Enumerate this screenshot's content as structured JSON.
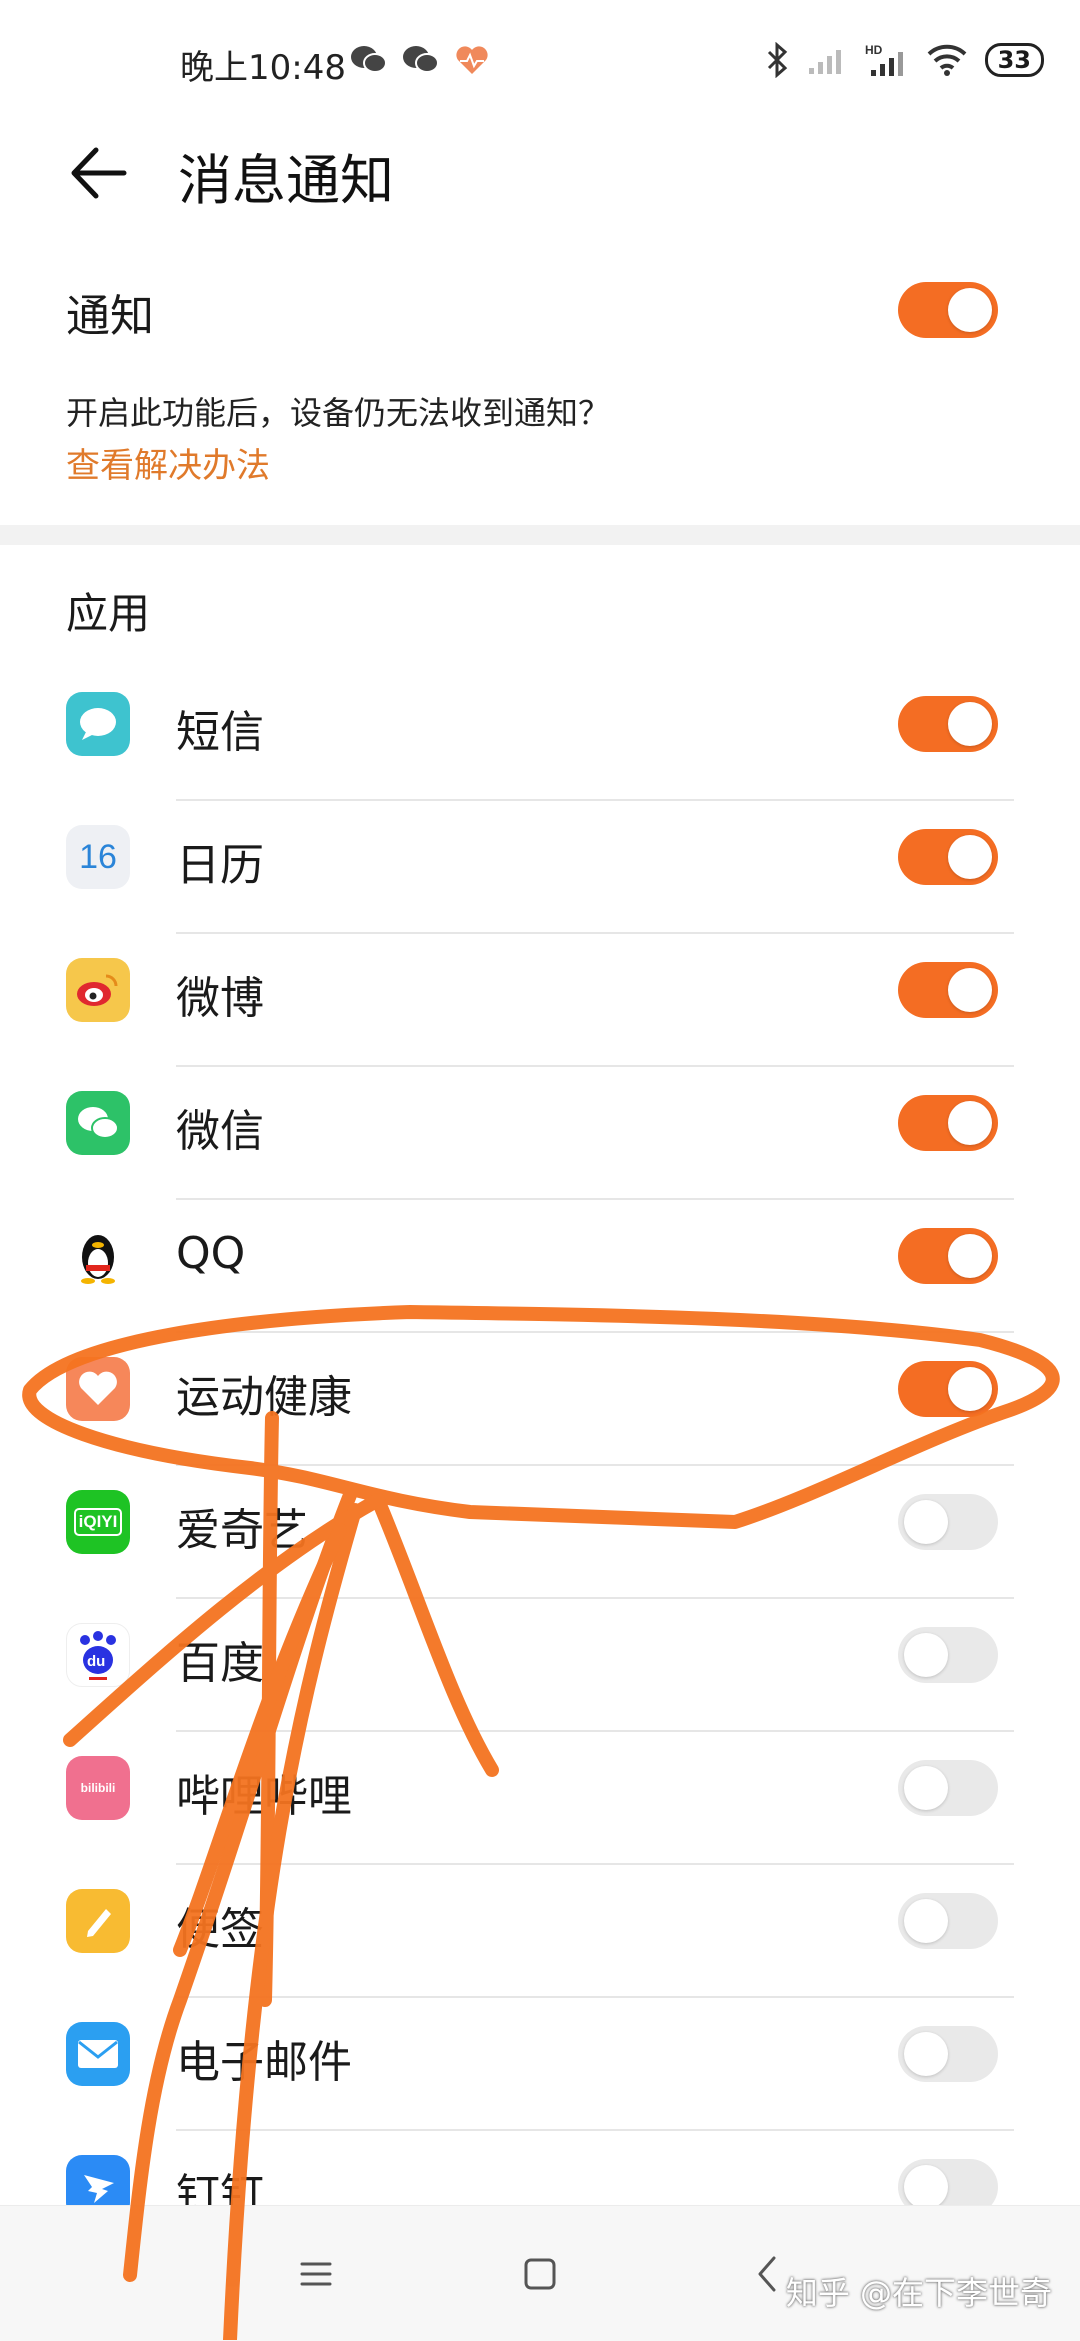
{
  "status_bar": {
    "time": "晚上10:48",
    "battery": "33",
    "left_icons": [
      "wechat-icon",
      "wechat-icon",
      "health-icon"
    ],
    "right_icons": [
      "bluetooth-icon",
      "signal-icon",
      "hd-signal-icon",
      "wifi-icon"
    ]
  },
  "header": {
    "title": "消息通知",
    "back_icon": "back-arrow-icon"
  },
  "notifications": {
    "label": "通知",
    "enabled": true,
    "description": "开启此功能后，设备仍无法收到通知？",
    "link": "查看解决办法"
  },
  "apps_section": {
    "label": "应用"
  },
  "apps": [
    {
      "name": "短信",
      "icon": "sms-icon",
      "color": "#3ec3cf",
      "enabled": true
    },
    {
      "name": "日历",
      "icon": "calendar-icon",
      "icon_text": "16",
      "color": "#eef0f4",
      "enabled": true
    },
    {
      "name": "微博",
      "icon": "weibo-icon",
      "color": "#f6c74b",
      "enabled": true
    },
    {
      "name": "微信",
      "icon": "wechat-app-icon",
      "color": "#2dc268",
      "enabled": true
    },
    {
      "name": "QQ",
      "icon": "qq-icon",
      "color": "#ffffff",
      "enabled": true
    },
    {
      "name": "运动健康",
      "icon": "health-app-icon",
      "color": "#f6875a",
      "enabled": true
    },
    {
      "name": "爱奇艺",
      "icon": "iqiyi-icon",
      "icon_text": "iQIYI",
      "color": "#1ec324",
      "enabled": false
    },
    {
      "name": "百度",
      "icon": "baidu-icon",
      "icon_text": "du",
      "color": "#ffffff",
      "enabled": false
    },
    {
      "name": "哔哩哔哩",
      "icon": "bilibili-icon",
      "icon_text": "bilibili",
      "color": "#f0708f",
      "enabled": false
    },
    {
      "name": "便签",
      "icon": "notes-icon",
      "color": "#f8bb32",
      "enabled": false
    },
    {
      "name": "电子邮件",
      "icon": "email-icon",
      "color": "#2b9ff1",
      "enabled": false
    },
    {
      "name": "钉钉",
      "icon": "dingtalk-icon",
      "color": "#2b8bf5",
      "enabled": false
    }
  ],
  "nav_bar": {
    "menu_icon": "menu-icon",
    "home_icon": "home-icon",
    "back_icon": "nav-back-icon"
  },
  "watermark": "知乎 @在下李世奇",
  "colors": {
    "accent": "#f46d23",
    "link": "#e07a2b",
    "annotation": "#f47320"
  }
}
